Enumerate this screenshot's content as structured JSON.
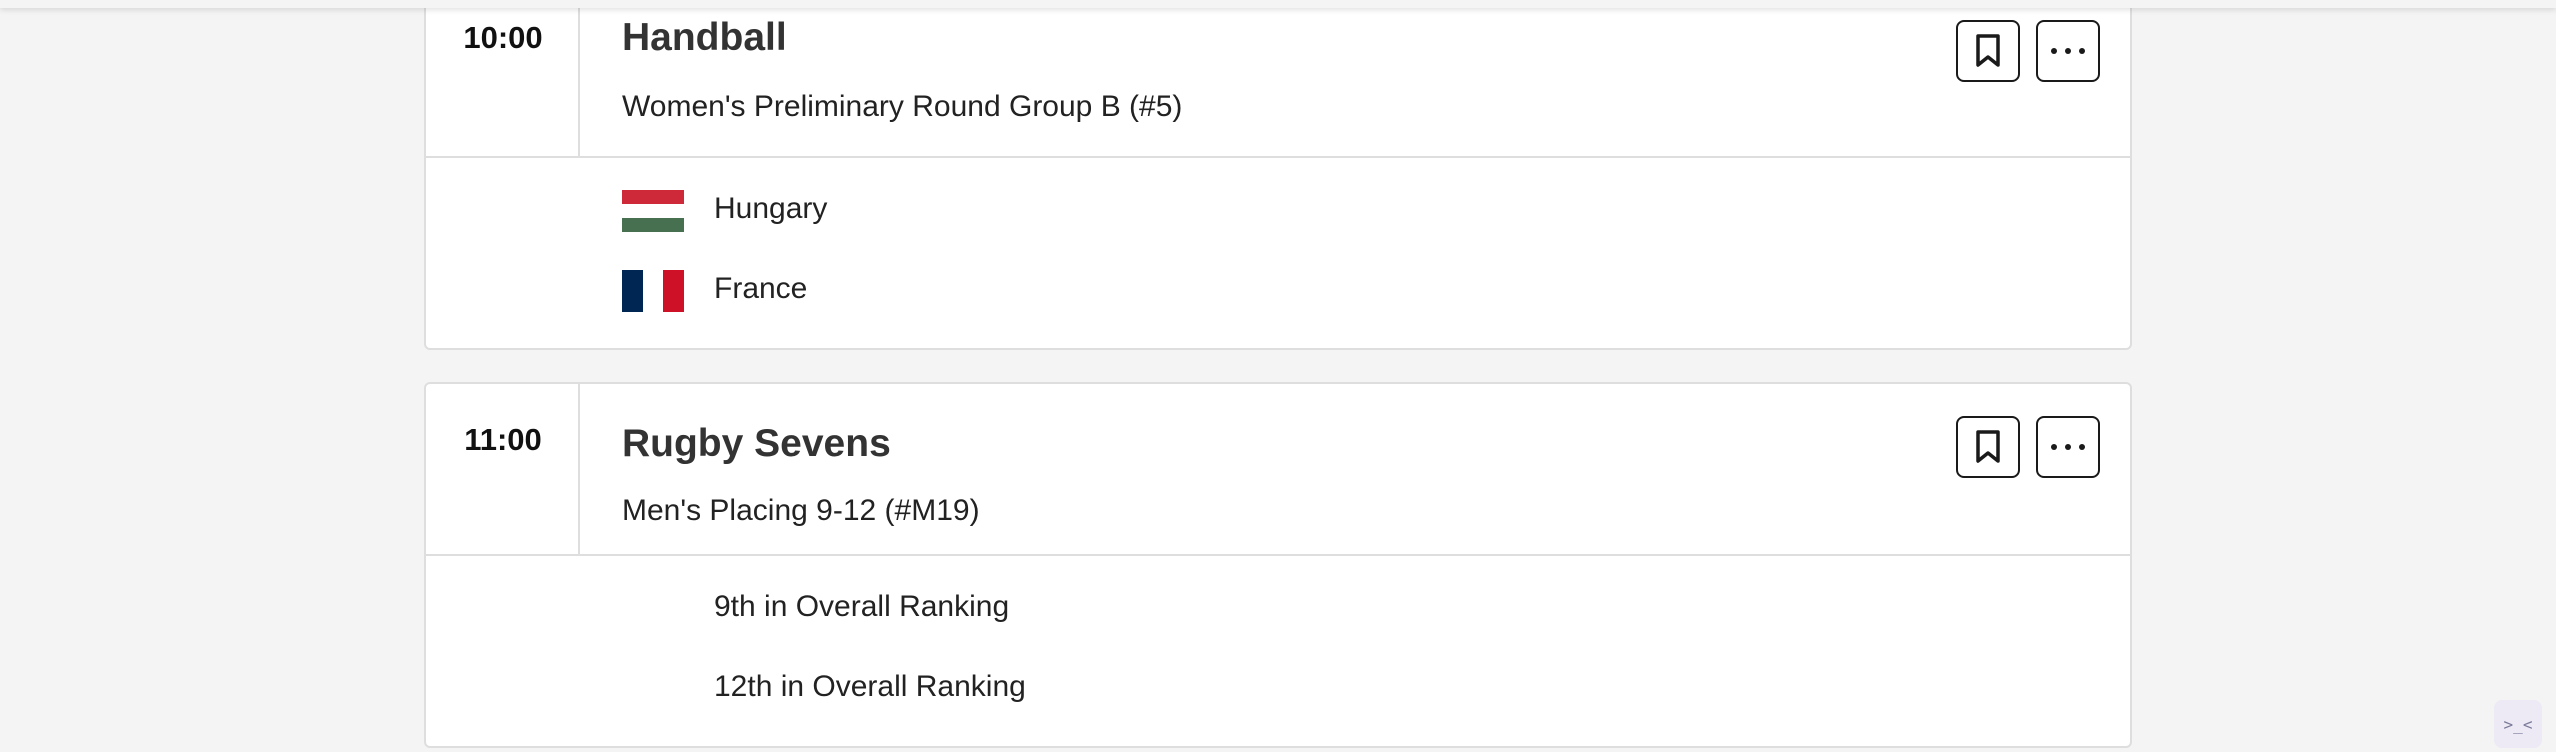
{
  "events": [
    {
      "time": "10:00",
      "sport": "Handball",
      "event": "Women's Preliminary Round Group B (#5)",
      "competitors": [
        {
          "name": "Hungary",
          "flag": "hungary-flag",
          "colors": [
            "#CE2939",
            "#FFFFFF",
            "#477050"
          ]
        },
        {
          "name": "France",
          "flag": "france-flag",
          "colors": [
            "#002654",
            "#FFFFFF",
            "#CE1126"
          ]
        }
      ]
    },
    {
      "time": "11:00",
      "sport": "Rugby Sevens",
      "event": "Men's Placing 9-12 (#M19)",
      "competitors": [
        {
          "name": "9th in Overall Ranking"
        },
        {
          "name": "12th in Overall Ranking"
        }
      ]
    }
  ],
  "icons": {
    "bookmark": "bookmark-icon",
    "more": "more-options-icon",
    "widget": "assistant-widget-icon"
  },
  "widget_label": ">_<"
}
